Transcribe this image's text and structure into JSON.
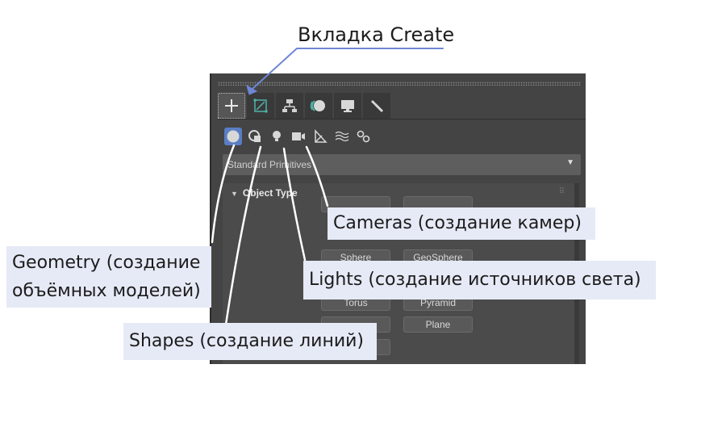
{
  "callouts": {
    "create_tab": "Вкладка Create",
    "cameras": "Cameras (создание камер)",
    "geometry_line1": "Geometry (создание",
    "geometry_line2": "объёмных моделей)",
    "lights": "Lights (создание источников света)",
    "shapes": "Shapes (создание линий)"
  },
  "panel": {
    "tabs": [
      {
        "icon": "plus-icon",
        "name": "Create",
        "active": true
      },
      {
        "icon": "modify-icon",
        "name": "Modify",
        "active": false
      },
      {
        "icon": "hierarchy-icon",
        "name": "Hierarchy",
        "active": false
      },
      {
        "icon": "motion-icon",
        "name": "Motion",
        "active": false
      },
      {
        "icon": "display-icon",
        "name": "Display",
        "active": false
      },
      {
        "icon": "wrench-icon",
        "name": "Utilities",
        "active": false
      }
    ],
    "categories": [
      {
        "icon": "geometry-icon",
        "selected": true
      },
      {
        "icon": "shapes-icon",
        "selected": false
      },
      {
        "icon": "lights-icon",
        "selected": false
      },
      {
        "icon": "cameras-icon",
        "selected": false
      },
      {
        "icon": "helpers-icon",
        "selected": false
      },
      {
        "icon": "space-warps-icon",
        "selected": false
      },
      {
        "icon": "systems-icon",
        "selected": false
      }
    ],
    "dropdown_value": "Standard Primitives",
    "rollout_title": "Object Type",
    "buttons": {
      "sphere": "Sphere",
      "geosphere": "GeoSphere",
      "torus": "Torus",
      "pyramid": "Pyramid",
      "plane": "Plane"
    }
  },
  "colors": {
    "panel_bg": "#444444",
    "selected_icon_bg": "#5a7ec4",
    "callout_bg": "#e6eaf6",
    "arrow": "#6f86d6"
  }
}
